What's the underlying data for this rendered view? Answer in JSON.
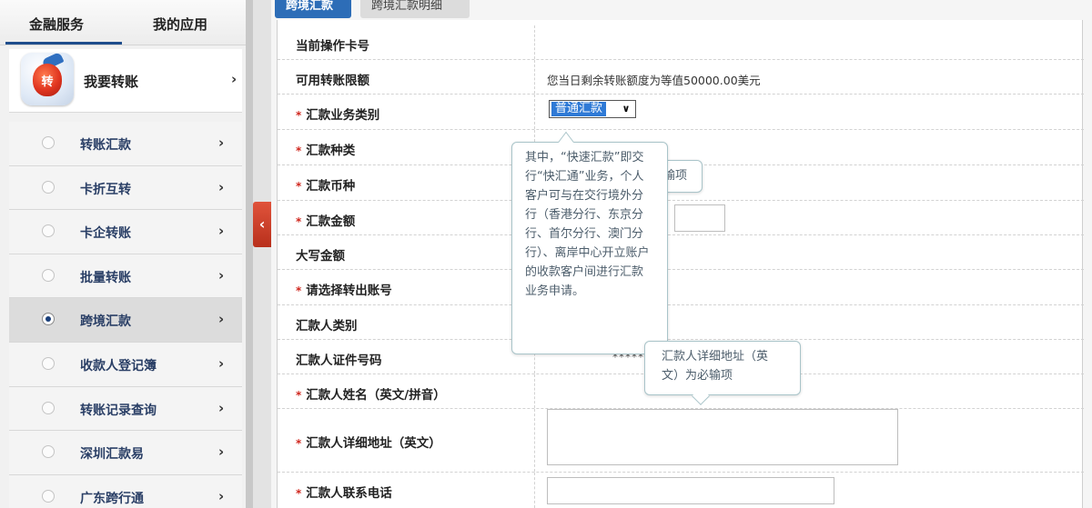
{
  "sidebar": {
    "tabs": [
      "金融服务",
      "我的应用"
    ],
    "feature": {
      "icon_text": "转",
      "label": "我要转账"
    },
    "items": [
      {
        "label": "转账汇款"
      },
      {
        "label": "卡折互转"
      },
      {
        "label": "卡企转账"
      },
      {
        "label": "批量转账"
      },
      {
        "label": "跨境汇款"
      },
      {
        "label": "收款人登记簿"
      },
      {
        "label": "转账记录查询"
      },
      {
        "label": "深圳汇款易"
      },
      {
        "label": "广东跨行通"
      }
    ],
    "active_item": "跨境汇款",
    "chevron": "›",
    "collapse_glyph": "‹"
  },
  "main": {
    "tabs": [
      "跨境汇款",
      "跨境汇款明细"
    ],
    "required_mark": "*",
    "form": {
      "rows": [
        {
          "label": "当前操作卡号",
          "required": false,
          "value": ""
        },
        {
          "label": "可用转账限额",
          "required": false,
          "value": "您当日剩余转账额度为等值50000.00美元"
        },
        {
          "label": "汇款业务类别",
          "required": true,
          "value": ""
        },
        {
          "label": "汇款种类",
          "required": true,
          "value": ""
        },
        {
          "label": "汇款币种",
          "required": true,
          "value": ""
        },
        {
          "label": "汇款金额",
          "required": true,
          "value": ""
        },
        {
          "label": "大写金额",
          "required": false,
          "value": ""
        },
        {
          "label": "请选择转出账号",
          "required": true,
          "value": ""
        },
        {
          "label": "汇款人类别",
          "required": false,
          "value": ""
        },
        {
          "label": "汇款人证件号码",
          "required": false,
          "value": "******"
        },
        {
          "label": "汇款人姓名（英文/拼音）",
          "required": true,
          "value": ""
        },
        {
          "label": "汇款人详细地址（英文）",
          "required": true,
          "value": ""
        },
        {
          "label": "汇款人联系电话",
          "required": true,
          "value": ""
        }
      ],
      "business_type_select": {
        "selected": "普通汇款",
        "arrow": "∨"
      }
    },
    "tooltips": {
      "quick_remit": "其中，“快速汇款”即交行“快汇通”业务，个人客户可与在交行境外分行（香港分行、东京分行、首尔分行、澳门分行）、离岸中心开立账户的收款客户间进行汇款业务申请。",
      "partial_hidden": "输项",
      "address": "汇款人详细地址（英文）为必输项"
    }
  }
}
